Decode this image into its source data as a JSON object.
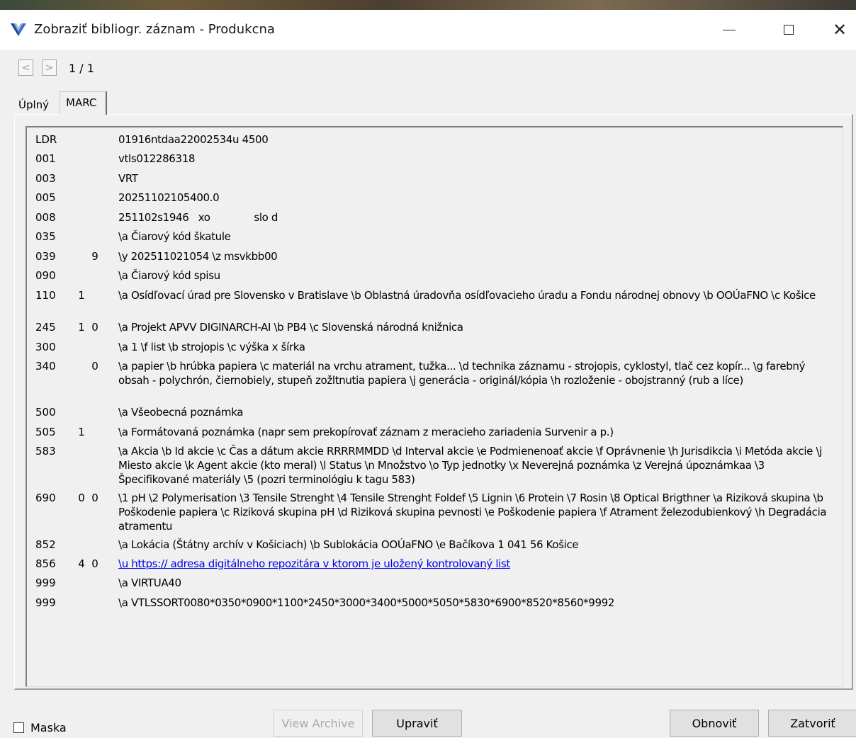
{
  "window": {
    "title": "Zobraziť bibliogr. záznam - Produkcna",
    "icon": "virtua-v-icon"
  },
  "navigation": {
    "prev_label": "<",
    "next_label": ">",
    "counter": "1 / 1"
  },
  "tabs": [
    {
      "label": "Úplný",
      "active": false
    },
    {
      "label": "MARC",
      "active": true
    }
  ],
  "record": [
    {
      "tag": "LDR",
      "ind1": "",
      "ind2": "",
      "value": "01916ntdaa22002534u 4500"
    },
    {
      "tag": "001",
      "ind1": "",
      "ind2": "",
      "value": "vtls012286318"
    },
    {
      "tag": "003",
      "ind1": "",
      "ind2": "",
      "value": "VRT"
    },
    {
      "tag": "005",
      "ind1": "",
      "ind2": "",
      "value": "20251102105400.0"
    },
    {
      "tag": "008",
      "ind1": "",
      "ind2": "",
      "value": "251102s1946   xo              slo d"
    },
    {
      "tag": "035",
      "ind1": "",
      "ind2": "",
      "value": "\\a Čiarový kód škatule"
    },
    {
      "tag": "039",
      "ind1": "",
      "ind2": "9",
      "value": "\\y 202511021054 \\z msvkbb00"
    },
    {
      "tag": "090",
      "ind1": "",
      "ind2": "",
      "value": "\\a Čiarový kód spisu"
    },
    {
      "tag": "110",
      "ind1": "1",
      "ind2": "",
      "value": "\\a Osídľovací úrad pre Slovensko v Bratislave \\b Oblastná úradovňa osídľovacieho úradu a Fondu národnej obnovy \\b OOÚaFNO \\c Košice"
    },
    {
      "tag": "245",
      "ind1": "1",
      "ind2": "0",
      "value": "\\a Projekt APVV DIGINARCH-AI \\b PB4 \\c Slovenská národná knižnica"
    },
    {
      "tag": "300",
      "ind1": "",
      "ind2": "",
      "value": "\\a 1 \\f list \\b strojopis \\c výška x šírka"
    },
    {
      "tag": "340",
      "ind1": "",
      "ind2": "0",
      "value": "\\a papier \\b hrúbka papiera \\c materiál na vrchu atrament, tužka... \\d technika záznamu - strojopis, cyklostyl, tlač cez kopír... \\g farebný obsah - polychrón, čiernobiely, stupeň zožltnutia papiera \\j generácia - originál/kópia \\h rozloženie - obojstranný (rub a líce)"
    },
    {
      "tag": "500",
      "ind1": "",
      "ind2": "",
      "value": "\\a Všeobecná poznámka"
    },
    {
      "tag": "505",
      "ind1": "1",
      "ind2": "",
      "value": "\\a Formátovaná poznámka (napr sem prekopírovať záznam z meracieho zariadenia Survenir a p.)"
    },
    {
      "tag": "583",
      "ind1": "",
      "ind2": "",
      "value": "\\a Akcia \\b Id akcie \\c Čas a dátum akcie RRRRMMDD \\d Interval akcie \\e Podmienenoať akcie \\f Oprávnenie \\h Jurisdikcia \\i Metóda akcie \\j Miesto akcie \\k Agent akcie (kto meral) \\l Status \\n Množstvo \\o Typ jednotky \\x Neverejná poznámka \\z Verejná úpoznámkaa \\3 Špecifikované materiály \\5 (pozri terminológiu k tagu 583)"
    },
    {
      "tag": "690",
      "ind1": "0",
      "ind2": "0",
      "value": "\\1 pH \\2 Polymerisation \\3 Tensile Strenght \\4 Tensile Strenght Foldef \\5 Lignin \\6 Protein \\7 Rosin \\8 Optical Brigthner \\a Riziková skupina \\b Poškodenie papiera \\c Riziková skupina pH \\d Riziková skupina pevnosti \\e Poškodenie papiera \\f Atrament železodubienkový \\h Degradácia atramentu"
    },
    {
      "tag": "852",
      "ind1": "",
      "ind2": "",
      "value": "\\a Lokácia (Štátny archív v Košiciach) \\b Sublokácia OOÚaFNO \\e Bačíkova 1 041 56 Košice"
    },
    {
      "tag": "856",
      "ind1": "4",
      "ind2": "0",
      "value": "\\u https:// adresa digitálneho repozitára v ktorom je uložený kontrolovaný list",
      "link": true
    },
    {
      "tag": "999",
      "ind1": "",
      "ind2": "",
      "value": "\\a VIRTUA40"
    },
    {
      "tag": "999",
      "ind1": "",
      "ind2": "",
      "value": "\\a VTLSSORT0080*0350*0900*1100*2450*3000*3400*5000*5050*5830*6900*8520*8560*9992"
    }
  ],
  "footer": {
    "mask_label": "Maska",
    "mask_checked": false,
    "view_archive_label": "View Archive",
    "edit_label": "Upraviť",
    "refresh_label": "Obnoviť",
    "close_label": "Zatvoriť"
  },
  "colors": {
    "link": "#0000ee",
    "window_bg": "#f0f0f0",
    "icon_blue": "#3a6fc4"
  }
}
